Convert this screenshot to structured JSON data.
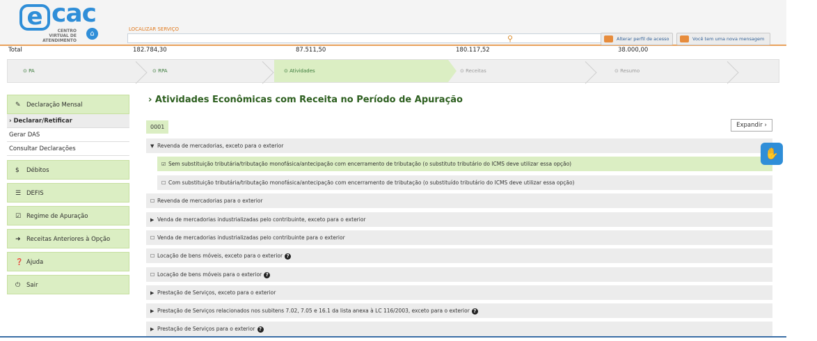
{
  "header": {
    "logo_main": "cac",
    "logo_e": "e",
    "logo_sub": "CENTRO VIRTUAL DE ATENDIMENTO",
    "search_label": "LOCALIZAR SERVIÇO",
    "search_value": "",
    "btn_perfil": "Alterar perfil de acesso",
    "btn_msg": "Você tem uma nova mensagem"
  },
  "totals": {
    "label": "Total",
    "v1": "182.784,30",
    "v2": "87.511,50",
    "v3": "180.117,52",
    "v4": "38.000,00"
  },
  "steps": [
    {
      "label": "PA",
      "state": "done"
    },
    {
      "label": "RPA",
      "state": "done"
    },
    {
      "label": "Atividades",
      "state": "active"
    },
    {
      "label": "Receitas",
      "state": "pending"
    },
    {
      "label": "Resumo",
      "state": "pending"
    }
  ],
  "sidebar": {
    "declaracao_mensal": "Declaração Mensal",
    "declarar_retificar": "Declarar/Retificar",
    "gerar_das": "Gerar DAS",
    "consultar": "Consultar Declarações",
    "debitos": "Débitos",
    "defis": "DEFIS",
    "regime": "Regime de Apuração",
    "receitas_anteriores": "Receitas Anteriores à Opção",
    "ajuda": "Ajuda",
    "sair": "Sair"
  },
  "main": {
    "title": "Atividades Econômicas com Receita no Período de Apuração",
    "tag": "0001",
    "expand": "Expandir",
    "rows": [
      "Revenda de mercadorias, exceto para o exterior",
      "Sem substituição tributária/tributação monofásica/antecipação com encerramento de tributação (o substituto tributário do ICMS deve utilizar essa opção)",
      "Com substituição tributária/tributação monofásica/antecipação com encerramento de tributação (o substituído tributário do ICMS deve utilizar essa opção)",
      "Revenda de mercadorias para o exterior",
      "Venda de mercadorias industrializadas pelo contribuinte, exceto para o exterior",
      "Venda de mercadorias industrializadas pelo contribuinte para o exterior",
      "Locação de bens móveis, exceto para o exterior",
      "Locação de bens móveis para o exterior",
      "Prestação de Serviços, exceto para o exterior",
      "Prestação de Serviços relacionados nos subitens 7.02, 7.05 e 16.1 da lista anexa à LC 116/2003, exceto para o exterior",
      "Prestação de Serviços para o exterior"
    ]
  }
}
